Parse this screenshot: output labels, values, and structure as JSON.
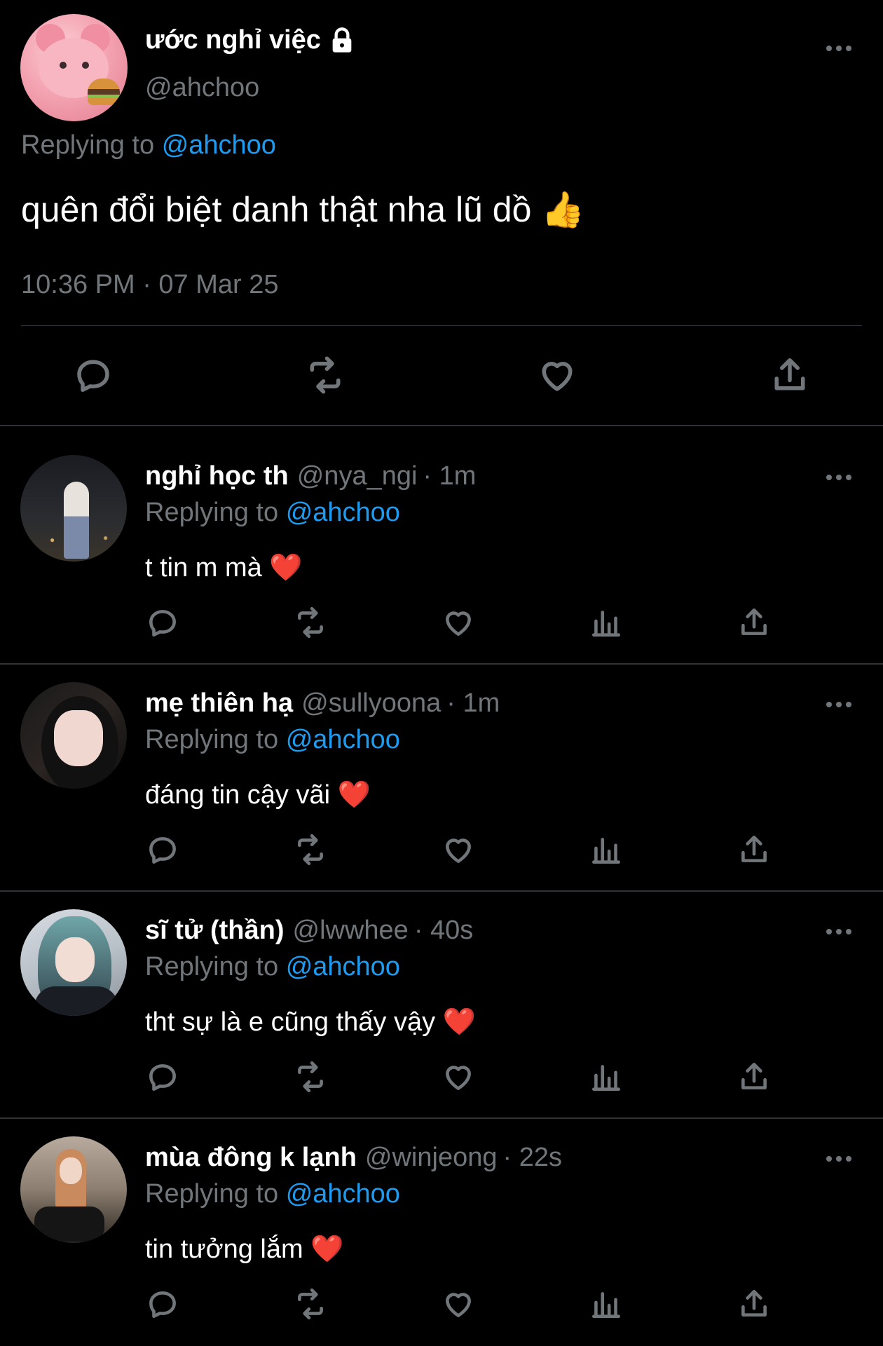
{
  "main_tweet": {
    "name": "ước nghỉ việc",
    "handle": "@ahchoo",
    "replying_prefix": "Replying to",
    "replying_handle": "@ahchoo",
    "text": "quên đổi biệt danh thật nha lũ dồ 👍",
    "timestamp": "10:36 PM · 07 Mar 25",
    "icons": [
      "lock-icon",
      "more-icon",
      "reply-icon",
      "retweet-icon",
      "like-icon",
      "share-icon"
    ]
  },
  "replies": [
    {
      "name": "nghỉ học th",
      "handle": "@nya_ngi",
      "time": "· 1m",
      "replying_prefix": "Replying to",
      "replying_handle": "@ahchoo",
      "text": "t tin m mà ❤️"
    },
    {
      "name": "mẹ thiên hạ",
      "handle": "@sullyoona",
      "time": "· 1m",
      "replying_prefix": "Replying to",
      "replying_handle": "@ahchoo",
      "text": "đáng tin cậy vãi ❤️"
    },
    {
      "name": "sĩ tử (thần)",
      "handle": "@lwwhee",
      "time": "· 40s",
      "replying_prefix": "Replying to",
      "replying_handle": "@ahchoo",
      "text": "tht sự là e cũng thấy vậy ❤️"
    },
    {
      "name": "mùa đông k lạnh",
      "handle": "@winjeong",
      "time": "· 22s",
      "replying_prefix": "Replying to",
      "replying_handle": "@ahchoo",
      "text": "tin tưởng lắm ❤️"
    }
  ],
  "colors": {
    "background": "#000000",
    "text": "#e7e9ea",
    "muted": "#71767b",
    "link": "#1d9bf0",
    "divider": "#2f3336"
  }
}
